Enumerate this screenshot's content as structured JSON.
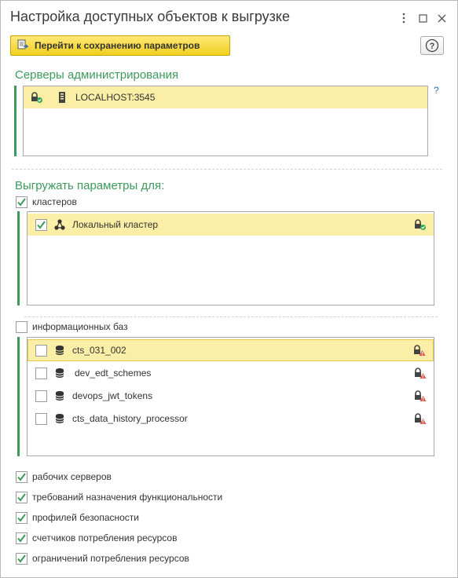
{
  "window": {
    "title": "Настройка доступных объектов к выгрузке",
    "menu_icon": "kebab-menu-icon",
    "maximize_icon": "maximize-icon",
    "close_icon": "close-icon"
  },
  "toolbar": {
    "save_settings_label": "Перейти к сохранению параметров",
    "help_label": "?"
  },
  "admin_servers": {
    "title": "Серверы администрирования",
    "help_link": "?",
    "items": [
      {
        "label": "LOCALHOST:3545",
        "selected": true
      }
    ]
  },
  "export_for": {
    "title": "Выгружать параметры для:",
    "clusters": {
      "label": "кластеров",
      "checked": true,
      "items": [
        {
          "label": "Локальный кластер",
          "checked": true,
          "status": "ok"
        }
      ]
    },
    "infobases": {
      "label": "информационных баз",
      "checked": false,
      "items": [
        {
          "label": "cts_031_002",
          "checked": false,
          "status": "warning"
        },
        {
          "label": "dev_edt_schemes",
          "checked": false,
          "status": "warning"
        },
        {
          "label": "devops_jwt_tokens",
          "checked": false,
          "status": "warning"
        },
        {
          "label": "cts_data_history_processor",
          "checked": false,
          "status": "warning"
        }
      ]
    },
    "options": [
      {
        "label": "рабочих серверов",
        "checked": true
      },
      {
        "label": "требований назначения функциональности",
        "checked": true
      },
      {
        "label": "профилей безопасности",
        "checked": true
      },
      {
        "label": "счетчиков потребления ресурсов",
        "checked": true
      },
      {
        "label": "ограничений потребления ресурсов",
        "checked": true
      }
    ]
  },
  "colors": {
    "accent_green": "#3d9a5a",
    "selection_yellow": "#fbeea6",
    "button_yellow": "#f2cf1f"
  }
}
